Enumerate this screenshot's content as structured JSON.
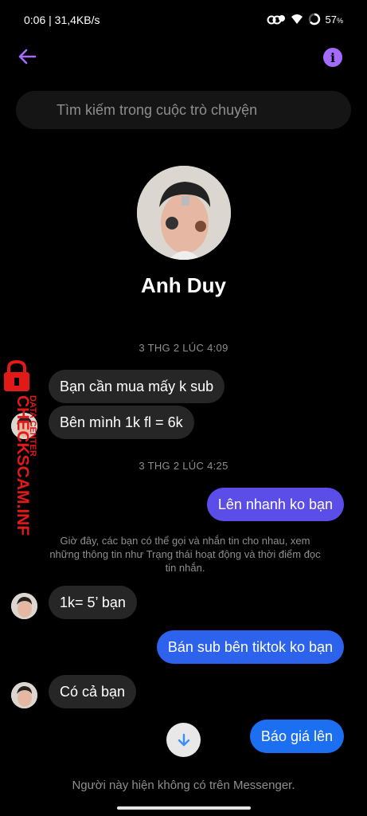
{
  "status_bar": {
    "time_speed": "0:06 | 31,4KB/s",
    "battery": "57",
    "battery_unit": "%"
  },
  "search": {
    "placeholder": "Tìm kiếm trong cuộc trò chuyện"
  },
  "profile": {
    "name": "Anh Duy"
  },
  "messages": {
    "timestamp_1": "3 THG 2 LÚC 4:09",
    "in_1": "Bạn cần mua mấy k sub",
    "in_2": "Bên mình 1k fl = 6k",
    "timestamp_2": "3 THG 2 LÚC 4:25",
    "out_1": "Lên nhanh ko bạn",
    "system_note": "Giờ đây, các bạn có thể gọi và nhắn tin cho nhau, xem những thông tin như Trạng thái hoạt động và thời điểm đọc tin nhắn.",
    "in_3": "1k= 5’ bạn",
    "out_2": "Bán sub bên tiktok ko bạn",
    "in_4": "Có cả bạn",
    "out_3": "Báo giá lên"
  },
  "footer": {
    "notice": "Người này hiện không có trên Messenger."
  },
  "watermark": {
    "top_text": "DATA CENTER",
    "brand": "CHECKSCAM.INFO"
  },
  "colors": {
    "background": "#000000",
    "incoming_bubble": "#262626",
    "outgoing_purple": "#5b4ee8",
    "outgoing_blue": "#1d6ff2",
    "accent": "#a56bff",
    "muted_text": "#8e8e8e",
    "watermark_red": "#e01919"
  },
  "icons": [
    "back-arrow-icon",
    "info-icon",
    "scroll-down-arrow-icon",
    "signal-icon",
    "wifi-icon",
    "battery-icon",
    "lock-icon"
  ]
}
